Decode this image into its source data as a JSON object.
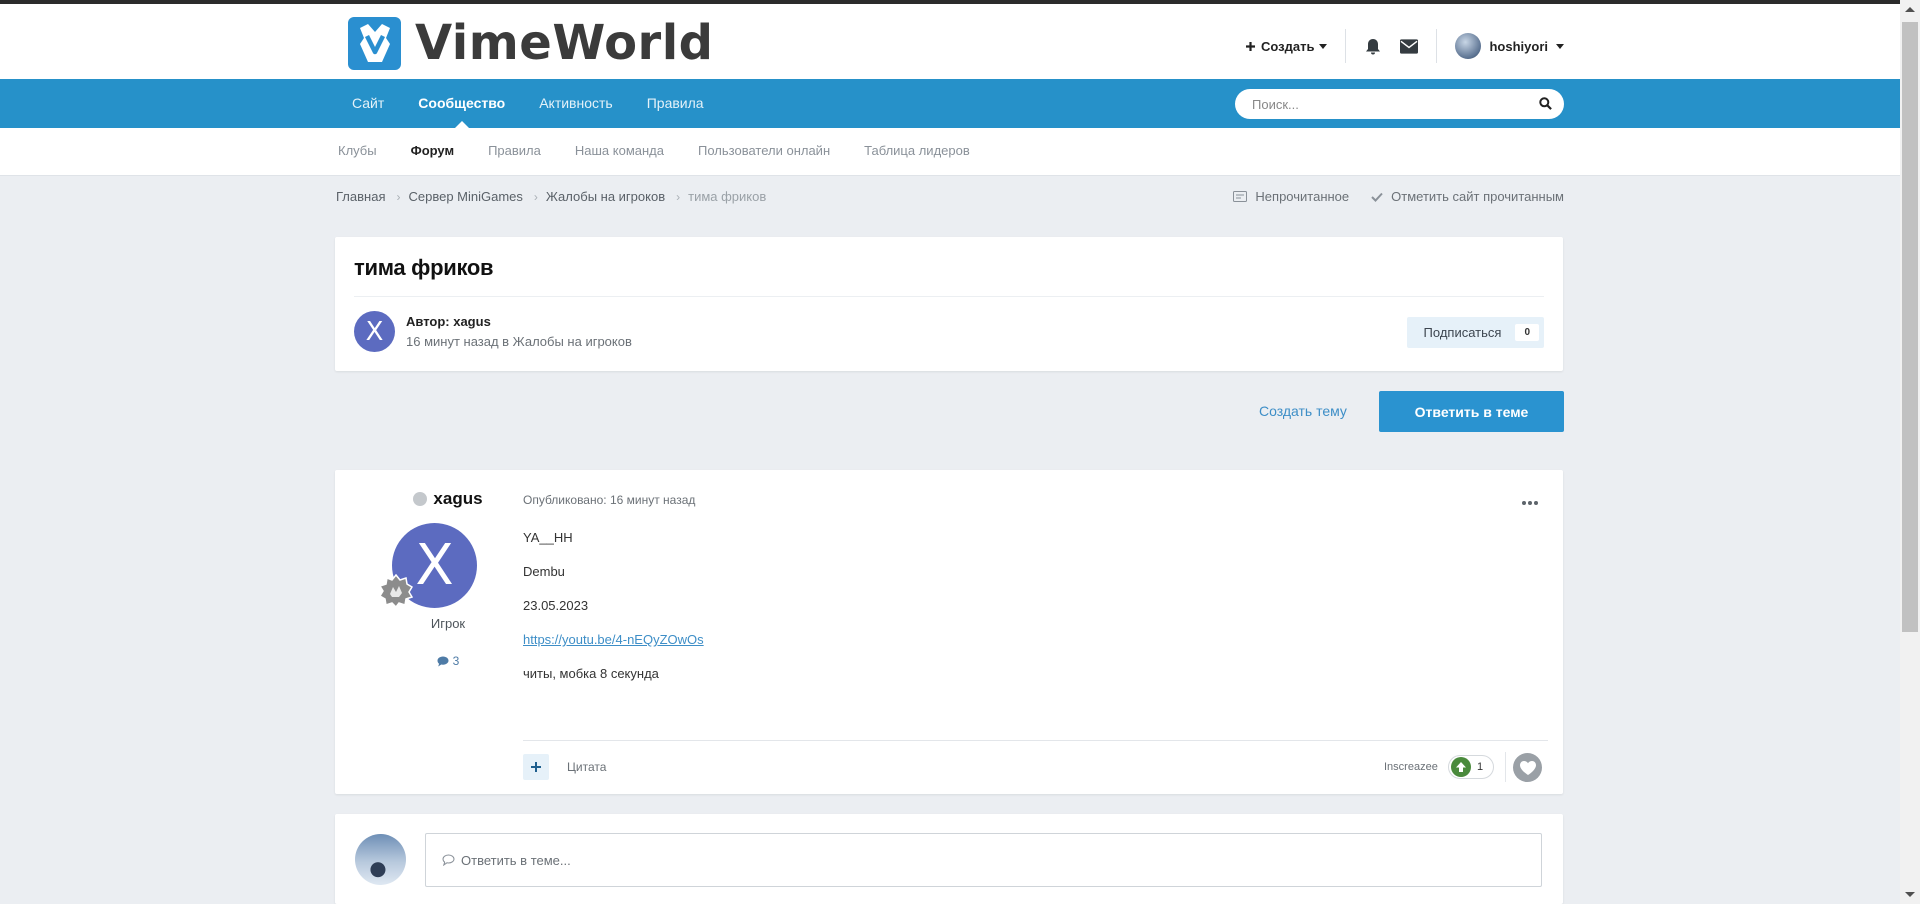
{
  "header": {
    "logo_text": "VimeWorld",
    "create_label": "Создать",
    "username": "hoshiyori"
  },
  "nav": {
    "items": [
      {
        "label": "Сайт"
      },
      {
        "label": "Сообщество"
      },
      {
        "label": "Активность"
      },
      {
        "label": "Правила"
      }
    ],
    "active_index": 1,
    "search_placeholder": "Поиск..."
  },
  "subnav": {
    "items": [
      {
        "label": "Клубы"
      },
      {
        "label": "Форум"
      },
      {
        "label": "Правила"
      },
      {
        "label": "Наша команда"
      },
      {
        "label": "Пользователи онлайн"
      },
      {
        "label": "Таблица лидеров"
      }
    ],
    "active_index": 1
  },
  "breadcrumb": {
    "items": [
      "Главная",
      "Сервер MiniGames",
      "Жалобы на игроков",
      "тима фриков"
    ],
    "unread_label": "Непрочитанное",
    "mark_read_label": "Отметить сайт прочитанным"
  },
  "topic": {
    "title": "тима фриков",
    "author_initial": "X",
    "author_line": "Автор: xagus",
    "meta_line": "16 минут назад в Жалобы на игроков",
    "follow_label": "Подписаться",
    "follow_count": "0"
  },
  "actions": {
    "create_topic": "Создать тему",
    "reply_topic": "Ответить в теме"
  },
  "post": {
    "author": "xagus",
    "avatar_initial": "X",
    "role": "Игрок",
    "post_count": "3",
    "date": "Опубликовано: 16 минут назад",
    "lines": [
      "YA__HH",
      "Dembu",
      "23.05.2023"
    ],
    "link": "https://youtu.be/4-nEQyZOwOs",
    "last_line": "читы, мобка 8 секунда",
    "quote_label": "Цитата",
    "reputation_user": "Inscreazee",
    "reputation_count": "1"
  },
  "reply": {
    "placeholder": "Ответить в теме..."
  },
  "colors": {
    "nav_bg": "#2691c9",
    "primary_button": "#2a93d0",
    "avatar_bg": "#5c6bc0",
    "page_bg": "#ebeef2"
  },
  "icons": [
    "plus-icon",
    "caret-down-icon",
    "bell-icon",
    "envelope-icon",
    "search-icon",
    "chevron-right-icon",
    "unread-icon",
    "check-icon",
    "ellipsis-icon",
    "comment-icon",
    "arrow-up-icon",
    "heart-icon",
    "speech-bubble-icon",
    "badge-icon"
  ]
}
